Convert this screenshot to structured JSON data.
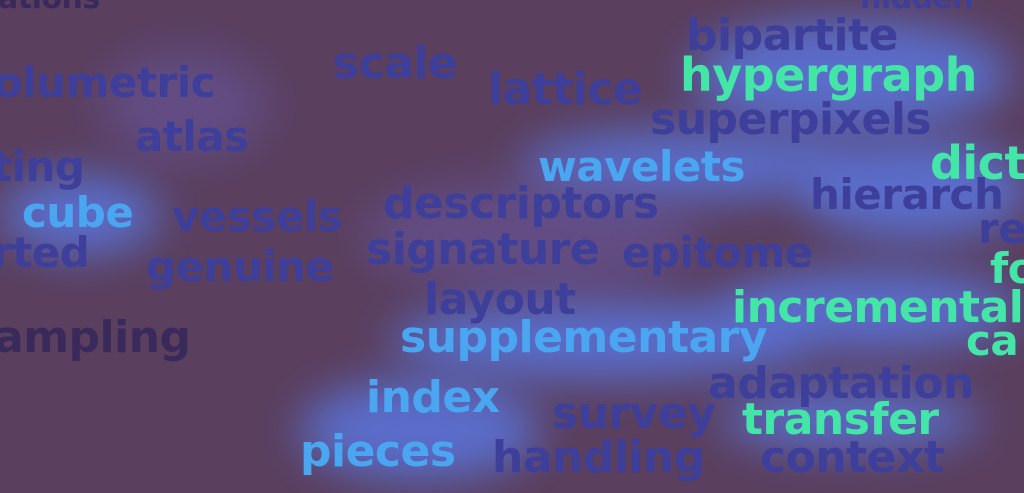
{
  "words": [
    {
      "text": "ations"
    },
    {
      "text": "hidden"
    },
    {
      "text": "bipartite"
    },
    {
      "text": "scale"
    },
    {
      "text": "olumetric"
    },
    {
      "text": "lattice"
    },
    {
      "text": "hypergraph"
    },
    {
      "text": "superpixels"
    },
    {
      "text": "atlas"
    },
    {
      "text": "ting"
    },
    {
      "text": "wavelets"
    },
    {
      "text": "dict"
    },
    {
      "text": "hierarch"
    },
    {
      "text": "cube"
    },
    {
      "text": "vessels"
    },
    {
      "text": "descriptors"
    },
    {
      "text": "re"
    },
    {
      "text": "rted"
    },
    {
      "text": "genuine"
    },
    {
      "text": "signature"
    },
    {
      "text": "epitome"
    },
    {
      "text": "fo"
    },
    {
      "text": "layout"
    },
    {
      "text": "incremental"
    },
    {
      "text": "ampling"
    },
    {
      "text": "supplementary"
    },
    {
      "text": "ca"
    },
    {
      "text": "adaptation"
    },
    {
      "text": "index"
    },
    {
      "text": "survey"
    },
    {
      "text": "transfer"
    },
    {
      "text": "pieces"
    },
    {
      "text": "handling"
    },
    {
      "text": "context"
    }
  ],
  "colors": {
    "background": "#5a3f5e",
    "word_blue": "#3d3f9a",
    "word_dark": "#3a2a5c",
    "word_cyan": "#4aa6f0",
    "word_green": "#44e6a8",
    "glow": "#5b7df0"
  }
}
